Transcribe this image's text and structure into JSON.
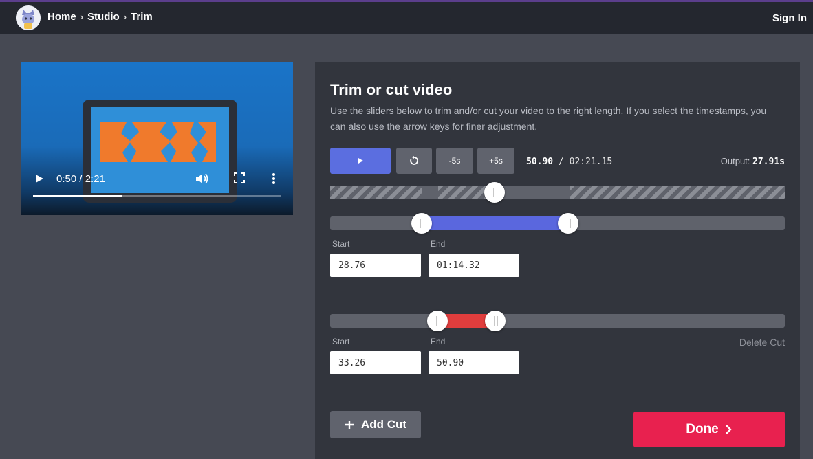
{
  "colors": {
    "accent_blue": "#5b6ee0",
    "cut_red": "#e03d3d",
    "done_pink": "#e8214f",
    "topbar": "#24272f",
    "panel": "#32353d"
  },
  "header": {
    "logo_icon": "cat-mascot-logo",
    "breadcrumb": [
      {
        "label": "Home"
      },
      {
        "label": "Studio"
      },
      {
        "label": "Trim"
      }
    ],
    "signin_label": "Sign In"
  },
  "video": {
    "time_label": "0:50 / 2:21",
    "progress": 0.36,
    "icons": [
      "play-icon",
      "volume-icon",
      "fullscreen-icon",
      "more-vert-icon"
    ]
  },
  "panel": {
    "title": "Trim or cut video",
    "description": "Use the sliders below to trim and/or cut your video to the right length. If you select the timestamps, you can also use the arrow keys for finer adjustment.",
    "controls": {
      "play_icon": "play-icon",
      "replay_icon": "replay-icon",
      "minus_label": "-5s",
      "plus_label": "+5s"
    },
    "current_time": "50.90",
    "separator": "/",
    "total_time": "02:21.15",
    "output_label": "Output:",
    "output_value": "27.91s",
    "trim": {
      "start_label": "Start",
      "start_value": "28.76",
      "end_label": "End",
      "end_value": "01:14.32"
    },
    "cut": {
      "start_label": "Start",
      "start_value": "33.26",
      "end_label": "End",
      "end_value": "50.90",
      "delete_label": "Delete Cut"
    },
    "add_cut_label": "Add Cut",
    "done_label": "Done"
  }
}
